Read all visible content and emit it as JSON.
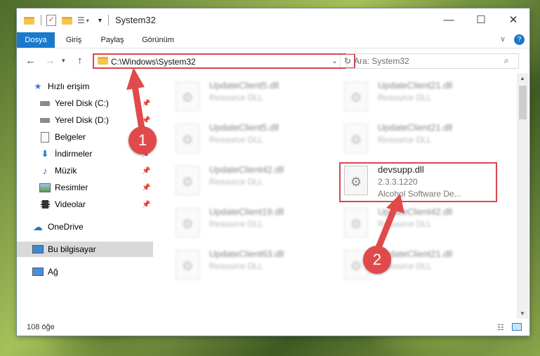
{
  "window": {
    "title": "System32",
    "controls": {
      "minimize": "—",
      "maximize": "☐",
      "close": "✕"
    }
  },
  "ribbon": {
    "tabs": [
      {
        "label": "Dosya",
        "active": true
      },
      {
        "label": "Giriş"
      },
      {
        "label": "Paylaş"
      },
      {
        "label": "Görünüm"
      }
    ],
    "help": "?"
  },
  "address": {
    "path": "C:\\Windows\\System32",
    "search_placeholder": "Ara: System32"
  },
  "sidebar": {
    "items": [
      {
        "label": "Hızlı erişim",
        "icon": "star-icon",
        "pinned": false
      },
      {
        "label": "Yerel Disk (C:)",
        "icon": "drive-icon",
        "pinned": true
      },
      {
        "label": "Yerel Disk (D:)",
        "icon": "drive-icon",
        "pinned": true
      },
      {
        "label": "Belgeler",
        "icon": "documents-icon",
        "pinned": true
      },
      {
        "label": "İndirmeler",
        "icon": "download-icon",
        "pinned": true
      },
      {
        "label": "Müzik",
        "icon": "music-icon",
        "pinned": true
      },
      {
        "label": "Resimler",
        "icon": "pictures-icon",
        "pinned": true
      },
      {
        "label": "Videolar",
        "icon": "videos-icon",
        "pinned": true
      },
      {
        "label": "OneDrive",
        "icon": "cloud-icon",
        "pinned": false
      },
      {
        "label": "Bu bilgisayar",
        "icon": "computer-icon",
        "pinned": false,
        "selected": true
      },
      {
        "label": "Ağ",
        "icon": "network-icon",
        "pinned": false
      }
    ]
  },
  "files": [
    {
      "name": "UpdateClient5.dll",
      "line2": "Resource DLL",
      "line3": "",
      "blurred": true
    },
    {
      "name": "UpdateClient21.dll",
      "line2": "Resource DLL",
      "line3": "",
      "blurred": true
    },
    {
      "name": "UpdateClient5.dll",
      "line2": "Resource DLL",
      "line3": "",
      "blurred": true
    },
    {
      "name": "UpdateClient21.dll",
      "line2": "Resource DLL",
      "line3": "",
      "blurred": true
    },
    {
      "name": "UpdateClient42.dll",
      "line2": "Resource DLL",
      "line3": "",
      "blurred": true
    },
    {
      "name": "devsupp.dll",
      "line2": "2.3.3.1220",
      "line3": "Alcohol Software De...",
      "blurred": false,
      "highlighted": true
    },
    {
      "name": "UpdateClient19.dll",
      "line2": "Resource DLL",
      "line3": "",
      "blurred": true
    },
    {
      "name": "UpdateClient42.dll",
      "line2": "Resource DLL",
      "line3": "",
      "blurred": true
    },
    {
      "name": "UpdateClient63.dll",
      "line2": "Resource DLL",
      "line3": "",
      "blurred": true
    },
    {
      "name": "UpdateClient21.dll",
      "line2": "Resource DLL",
      "line3": "",
      "blurred": true
    }
  ],
  "status": {
    "count": "108 öğe"
  },
  "annotations": {
    "marker1": "1",
    "marker2": "2",
    "color": "#e04a4a"
  },
  "colors": {
    "accent": "#1979ca",
    "highlight": "#d9474f"
  }
}
